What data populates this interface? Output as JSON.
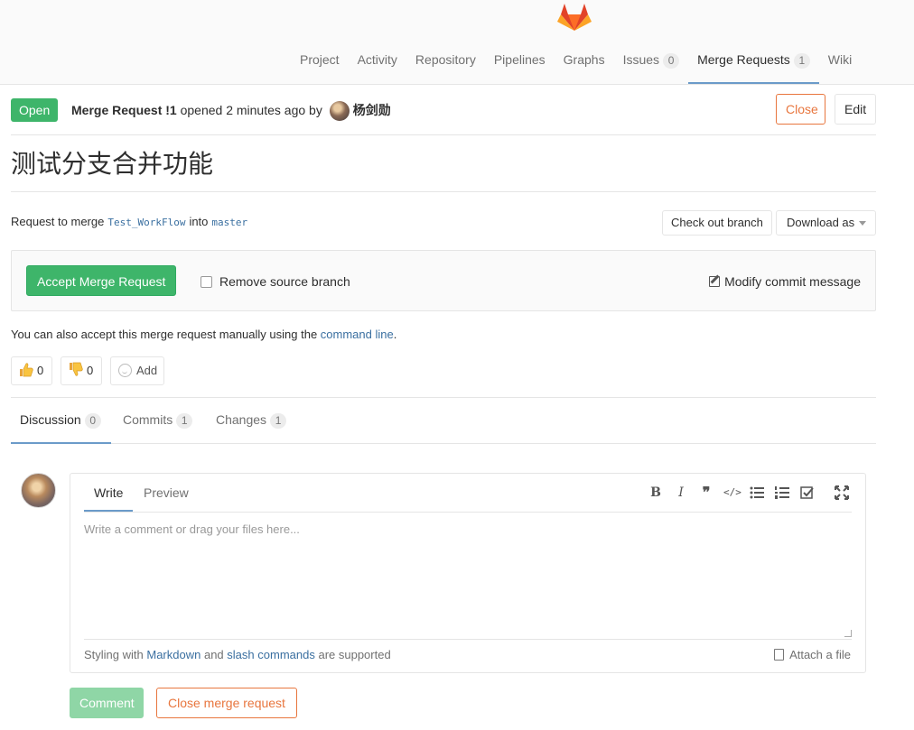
{
  "nav": {
    "tabs": [
      {
        "label": "Project"
      },
      {
        "label": "Activity"
      },
      {
        "label": "Repository"
      },
      {
        "label": "Pipelines"
      },
      {
        "label": "Graphs"
      },
      {
        "label": "Issues",
        "count": "0"
      },
      {
        "label": "Merge Requests",
        "count": "1",
        "active": true
      },
      {
        "label": "Wiki"
      }
    ]
  },
  "header": {
    "status": "Open",
    "mr_ref": "Merge Request !1",
    "opened_text": "opened 2 minutes ago by",
    "author": "杨剑勋",
    "close_label": "Close",
    "edit_label": "Edit"
  },
  "title": "测试分支合并功能",
  "merge_info": {
    "prefix": "Request to merge",
    "source_branch": "Test_WorkFlow",
    "middle": "into",
    "target_branch": "master",
    "checkout_label": "Check out branch",
    "download_label": "Download as"
  },
  "accept": {
    "button_label": "Accept Merge Request",
    "remove_source_label": "Remove source branch",
    "modify_label": "Modify commit message"
  },
  "manual_note": {
    "text": "You can also accept this merge request manually using the",
    "link": "command line",
    "suffix": "."
  },
  "awards": {
    "thumbs_up": "0",
    "thumbs_down": "0",
    "add_label": "Add"
  },
  "discussion_tabs": [
    {
      "label": "Discussion",
      "count": "0"
    },
    {
      "label": "Commits",
      "count": "1"
    },
    {
      "label": "Changes",
      "count": "1"
    }
  ],
  "editor": {
    "write_tab": "Write",
    "preview_tab": "Preview",
    "placeholder": "Write a comment or drag your files here...",
    "footer_prefix": "Styling with",
    "markdown_link": "Markdown",
    "and": "and",
    "slash_link": "slash commands",
    "footer_suffix": "are supported",
    "attach_label": "Attach a file",
    "toolbar": [
      "bold-icon",
      "italic-icon",
      "quote-icon",
      "code-icon",
      "bullet-list-icon",
      "numbered-list-icon",
      "task-list-icon",
      "fullscreen-icon"
    ]
  },
  "actions": {
    "comment_label": "Comment",
    "close_mr_label": "Close merge request"
  },
  "colors": {
    "green": "#3eb56a",
    "orange": "#e8763e",
    "link": "#3a6fa0",
    "active_underline": "#6b9bc9"
  }
}
